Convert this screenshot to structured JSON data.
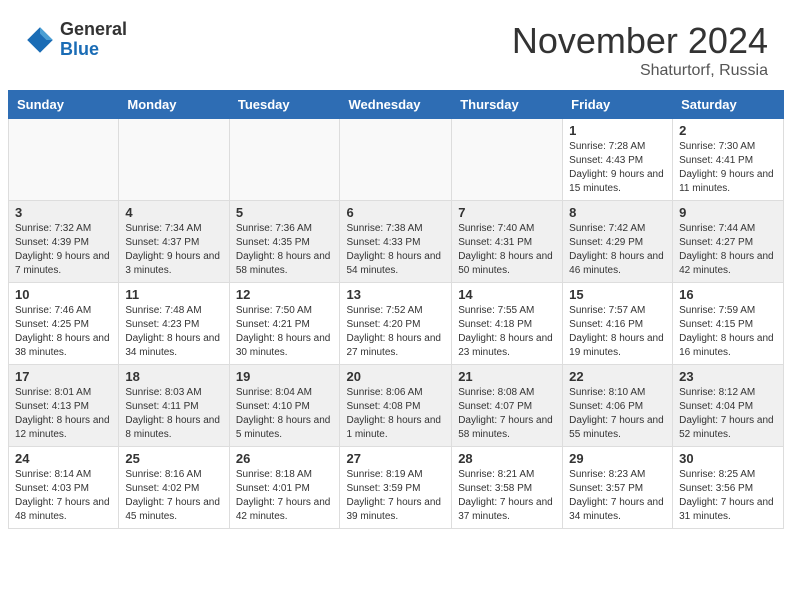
{
  "header": {
    "logo_general": "General",
    "logo_blue": "Blue",
    "month_title": "November 2024",
    "location": "Shaturtorf, Russia"
  },
  "days_of_week": [
    "Sunday",
    "Monday",
    "Tuesday",
    "Wednesday",
    "Thursday",
    "Friday",
    "Saturday"
  ],
  "weeks": [
    {
      "shaded": false,
      "days": [
        {
          "number": "",
          "info": ""
        },
        {
          "number": "",
          "info": ""
        },
        {
          "number": "",
          "info": ""
        },
        {
          "number": "",
          "info": ""
        },
        {
          "number": "",
          "info": ""
        },
        {
          "number": "1",
          "info": "Sunrise: 7:28 AM\nSunset: 4:43 PM\nDaylight: 9 hours and 15 minutes."
        },
        {
          "number": "2",
          "info": "Sunrise: 7:30 AM\nSunset: 4:41 PM\nDaylight: 9 hours and 11 minutes."
        }
      ]
    },
    {
      "shaded": true,
      "days": [
        {
          "number": "3",
          "info": "Sunrise: 7:32 AM\nSunset: 4:39 PM\nDaylight: 9 hours and 7 minutes."
        },
        {
          "number": "4",
          "info": "Sunrise: 7:34 AM\nSunset: 4:37 PM\nDaylight: 9 hours and 3 minutes."
        },
        {
          "number": "5",
          "info": "Sunrise: 7:36 AM\nSunset: 4:35 PM\nDaylight: 8 hours and 58 minutes."
        },
        {
          "number": "6",
          "info": "Sunrise: 7:38 AM\nSunset: 4:33 PM\nDaylight: 8 hours and 54 minutes."
        },
        {
          "number": "7",
          "info": "Sunrise: 7:40 AM\nSunset: 4:31 PM\nDaylight: 8 hours and 50 minutes."
        },
        {
          "number": "8",
          "info": "Sunrise: 7:42 AM\nSunset: 4:29 PM\nDaylight: 8 hours and 46 minutes."
        },
        {
          "number": "9",
          "info": "Sunrise: 7:44 AM\nSunset: 4:27 PM\nDaylight: 8 hours and 42 minutes."
        }
      ]
    },
    {
      "shaded": false,
      "days": [
        {
          "number": "10",
          "info": "Sunrise: 7:46 AM\nSunset: 4:25 PM\nDaylight: 8 hours and 38 minutes."
        },
        {
          "number": "11",
          "info": "Sunrise: 7:48 AM\nSunset: 4:23 PM\nDaylight: 8 hours and 34 minutes."
        },
        {
          "number": "12",
          "info": "Sunrise: 7:50 AM\nSunset: 4:21 PM\nDaylight: 8 hours and 30 minutes."
        },
        {
          "number": "13",
          "info": "Sunrise: 7:52 AM\nSunset: 4:20 PM\nDaylight: 8 hours and 27 minutes."
        },
        {
          "number": "14",
          "info": "Sunrise: 7:55 AM\nSunset: 4:18 PM\nDaylight: 8 hours and 23 minutes."
        },
        {
          "number": "15",
          "info": "Sunrise: 7:57 AM\nSunset: 4:16 PM\nDaylight: 8 hours and 19 minutes."
        },
        {
          "number": "16",
          "info": "Sunrise: 7:59 AM\nSunset: 4:15 PM\nDaylight: 8 hours and 16 minutes."
        }
      ]
    },
    {
      "shaded": true,
      "days": [
        {
          "number": "17",
          "info": "Sunrise: 8:01 AM\nSunset: 4:13 PM\nDaylight: 8 hours and 12 minutes."
        },
        {
          "number": "18",
          "info": "Sunrise: 8:03 AM\nSunset: 4:11 PM\nDaylight: 8 hours and 8 minutes."
        },
        {
          "number": "19",
          "info": "Sunrise: 8:04 AM\nSunset: 4:10 PM\nDaylight: 8 hours and 5 minutes."
        },
        {
          "number": "20",
          "info": "Sunrise: 8:06 AM\nSunset: 4:08 PM\nDaylight: 8 hours and 1 minute."
        },
        {
          "number": "21",
          "info": "Sunrise: 8:08 AM\nSunset: 4:07 PM\nDaylight: 7 hours and 58 minutes."
        },
        {
          "number": "22",
          "info": "Sunrise: 8:10 AM\nSunset: 4:06 PM\nDaylight: 7 hours and 55 minutes."
        },
        {
          "number": "23",
          "info": "Sunrise: 8:12 AM\nSunset: 4:04 PM\nDaylight: 7 hours and 52 minutes."
        }
      ]
    },
    {
      "shaded": false,
      "days": [
        {
          "number": "24",
          "info": "Sunrise: 8:14 AM\nSunset: 4:03 PM\nDaylight: 7 hours and 48 minutes."
        },
        {
          "number": "25",
          "info": "Sunrise: 8:16 AM\nSunset: 4:02 PM\nDaylight: 7 hours and 45 minutes."
        },
        {
          "number": "26",
          "info": "Sunrise: 8:18 AM\nSunset: 4:01 PM\nDaylight: 7 hours and 42 minutes."
        },
        {
          "number": "27",
          "info": "Sunrise: 8:19 AM\nSunset: 3:59 PM\nDaylight: 7 hours and 39 minutes."
        },
        {
          "number": "28",
          "info": "Sunrise: 8:21 AM\nSunset: 3:58 PM\nDaylight: 7 hours and 37 minutes."
        },
        {
          "number": "29",
          "info": "Sunrise: 8:23 AM\nSunset: 3:57 PM\nDaylight: 7 hours and 34 minutes."
        },
        {
          "number": "30",
          "info": "Sunrise: 8:25 AM\nSunset: 3:56 PM\nDaylight: 7 hours and 31 minutes."
        }
      ]
    }
  ]
}
